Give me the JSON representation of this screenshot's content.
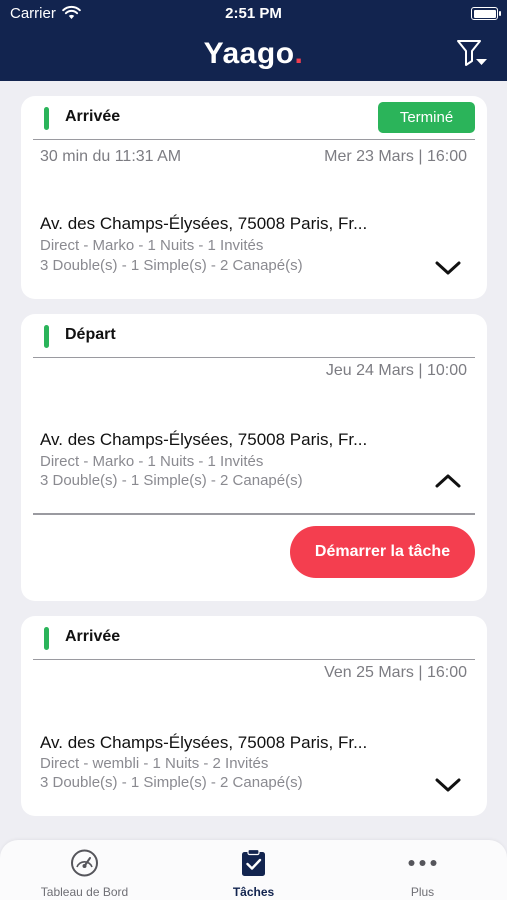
{
  "status_bar": {
    "carrier": "Carrier",
    "time": "2:51 PM"
  },
  "header": {
    "logo_text": "Yaago",
    "logo_dot": ".",
    "filter_icon": "filter-icon"
  },
  "tasks": [
    {
      "type": "Arrivée",
      "status_badge": "Terminé",
      "eta": "30 min du 11:31 AM",
      "date": "Mer 23 Mars | 16:00",
      "address": "Av. des Champs-Élysées, 75008 Paris, Fr...",
      "details": "Direct - Marko - 1 Nuits - 1 Invités",
      "rooms": "3 Double(s)  - 1 Simple(s) - 2 Canapé(s)",
      "expanded": false
    },
    {
      "type": "Départ",
      "date": "Jeu 24 Mars | 10:00",
      "address": "Av. des Champs-Élysées, 75008 Paris, Fr...",
      "details": "Direct - Marko - 1 Nuits - 1 Invités",
      "rooms": "3 Double(s)  - 1 Simple(s) - 2 Canapé(s)",
      "expanded": true,
      "action_label": "Démarrer la tâche"
    },
    {
      "type": "Arrivée",
      "date": "Ven 25 Mars | 16:00",
      "address": "Av. des Champs-Élysées, 75008 Paris, Fr...",
      "details": "Direct - wembli - 1 Nuits - 2 Invités",
      "rooms": "3 Double(s)  - 1 Simple(s) - 2 Canapé(s)",
      "expanded": false
    }
  ],
  "tab_bar": {
    "items": [
      {
        "label": "Tableau de Bord",
        "icon": "dashboard-gauge-icon",
        "active": false
      },
      {
        "label": "Tâches",
        "icon": "clipboard-check-icon",
        "active": true
      },
      {
        "label": "Plus",
        "icon": "more-dots-icon",
        "active": false
      }
    ]
  },
  "colors": {
    "header_bg": "#12244f",
    "accent_green": "#2bb45a",
    "accent_red": "#f43e4f",
    "brand_dot": "#f03e4f",
    "background": "#eeeef3"
  }
}
